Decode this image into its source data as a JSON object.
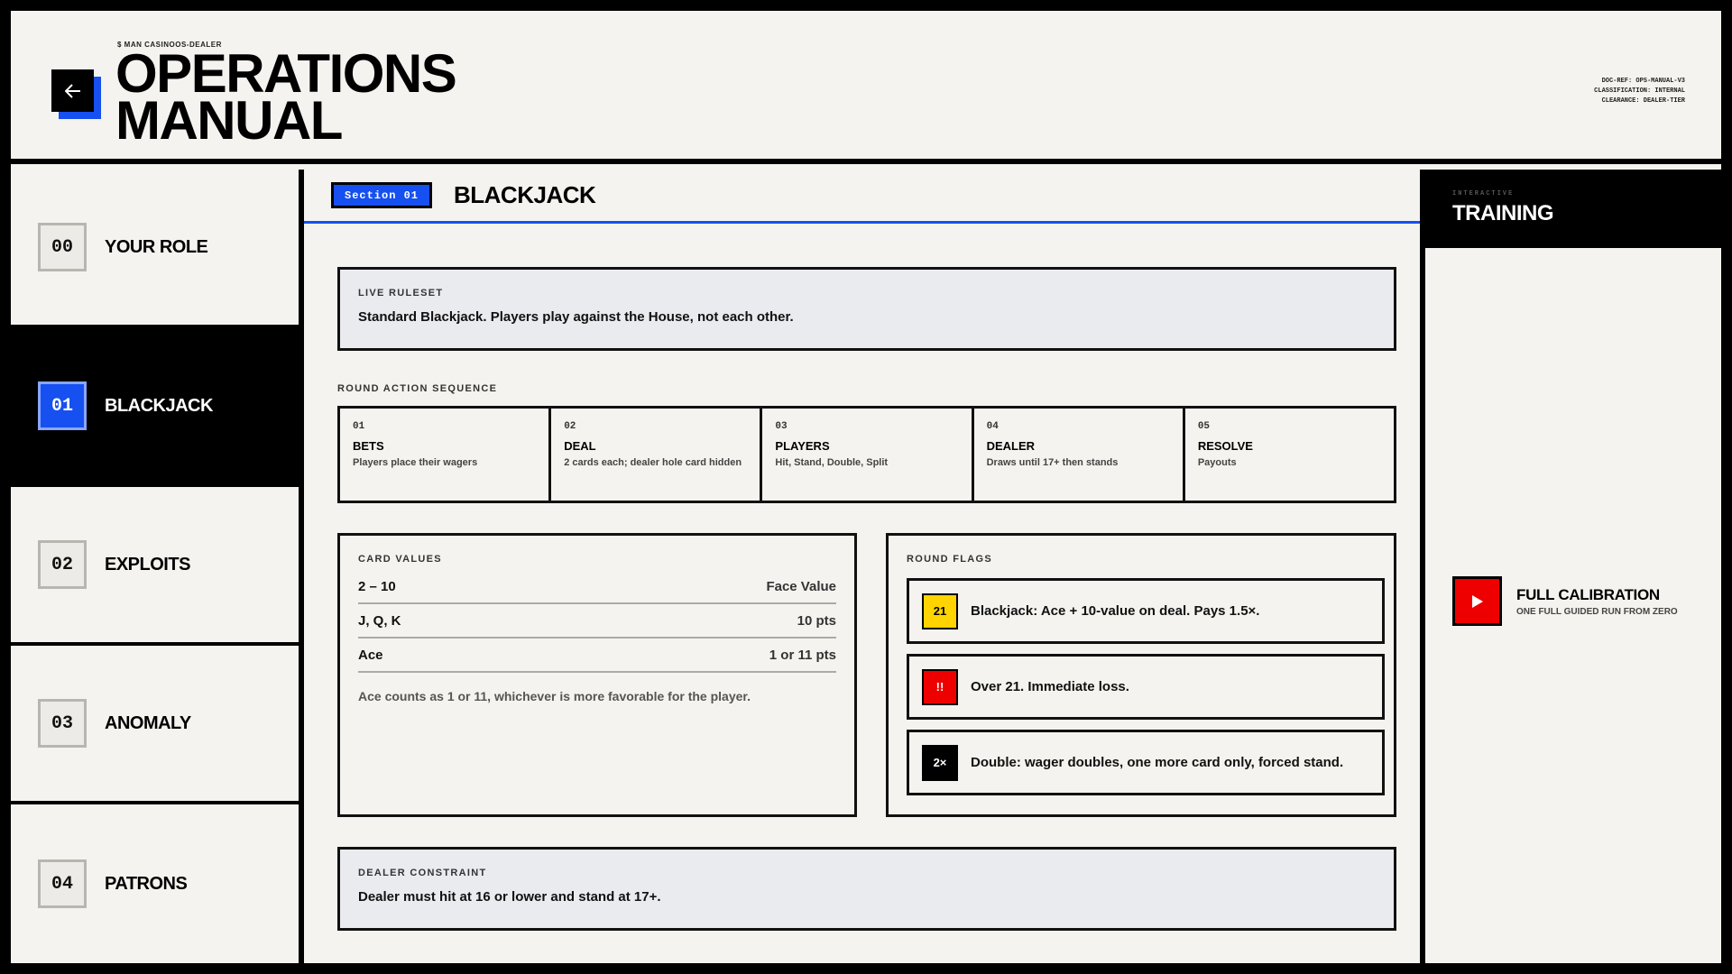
{
  "header": {
    "kicker": "$ MAN CASINOOS-DEALER",
    "title_line1": "OPERATIONS",
    "title_line2": "MANUAL",
    "doc_ref": "DOC-REF: OPS-MANUAL-V3",
    "classification": "CLASSIFICATION: INTERNAL",
    "clearance": "CLEARANCE: DEALER-TIER",
    "back_icon": "arrow-left-icon"
  },
  "sidebar": {
    "items": [
      {
        "num": "00",
        "label": "YOUR ROLE"
      },
      {
        "num": "01",
        "label": "BLACKJACK"
      },
      {
        "num": "02",
        "label": "EXPLOITS"
      },
      {
        "num": "03",
        "label": "ANOMALY"
      },
      {
        "num": "04",
        "label": "PATRONS"
      }
    ],
    "active_index": 1
  },
  "main": {
    "section_badge": "Section 01",
    "section_title": "BLACKJACK",
    "ruleset": {
      "label": "LIVE RULESET",
      "text": "Standard Blackjack. Players play against the House, not each other."
    },
    "sequence_label": "ROUND ACTION SEQUENCE",
    "steps": [
      {
        "num": "01",
        "title": "BETS",
        "desc": "Players place their wagers"
      },
      {
        "num": "02",
        "title": "DEAL",
        "desc": "2 cards each; dealer hole card hidden"
      },
      {
        "num": "03",
        "title": "PLAYERS",
        "desc": "Hit, Stand, Double, Split"
      },
      {
        "num": "04",
        "title": "DEALER",
        "desc": "Draws until 17+ then stands"
      },
      {
        "num": "05",
        "title": "RESOLVE",
        "desc": "Payouts"
      }
    ],
    "card_values": {
      "label": "CARD VALUES",
      "rows": [
        {
          "card": "2 – 10",
          "value": "Face Value"
        },
        {
          "card": "J, Q, K",
          "value": "10 pts"
        },
        {
          "card": "Ace",
          "value": "1 or 11 pts"
        }
      ],
      "note": "Ace counts as 1 or 11, whichever is more favorable for the player."
    },
    "flags": {
      "label": "ROUND FLAGS",
      "items": [
        {
          "icon": "21",
          "color": "#ffd400",
          "fg": "#000000",
          "text": "Blackjack: Ace + 10-value on deal. Pays 1.5×."
        },
        {
          "icon": "!!",
          "color": "#ee0000",
          "fg": "#ffffff",
          "text": "Over 21. Immediate loss."
        },
        {
          "icon": "2×",
          "color": "#000000",
          "fg": "#ffffff",
          "text": "Double: wager doubles, one more card only, forced stand."
        }
      ]
    },
    "constraint": {
      "label": "DEALER CONSTRAINT",
      "text": "Dealer must hit at 16 or lower and stand at 17+."
    }
  },
  "training": {
    "kicker": "INTERACTIVE",
    "title": "TRAINING",
    "calibration_title": "FULL CALIBRATION",
    "calibration_sub": "ONE FULL GUIDED RUN FROM ZERO",
    "play_icon": "play-icon"
  },
  "colors": {
    "accent": "#1650f0",
    "background": "#f4f3ef",
    "panel_tint": "#eaebef",
    "danger": "#ee0000",
    "warning": "#ffd400"
  }
}
